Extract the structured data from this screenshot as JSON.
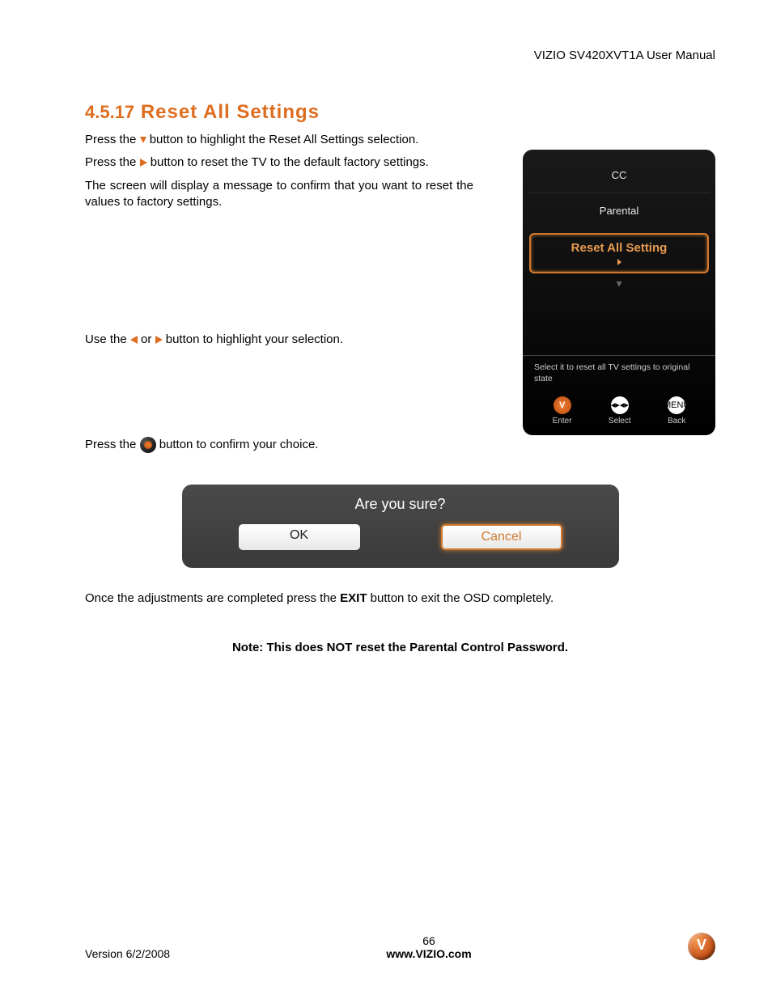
{
  "header": {
    "manual_title": "VIZIO SV420XVT1A User Manual"
  },
  "section": {
    "number": "4.5.17",
    "title": "Reset All Settings"
  },
  "paragraphs": {
    "p1a": "Press the ",
    "p1b": " button to highlight the Reset All Settings selection.",
    "p2a": "Press the ",
    "p2b": " button to reset the TV to the default factory settings.",
    "p3": "The screen will display a message to confirm that you want to reset the values to factory settings.",
    "p4a": "Use the ",
    "p4b": " or ",
    "p4c": " button to highlight your selection.",
    "p5a": "Press the ",
    "p5b": " button to confirm your choice.",
    "p6a": "Once the adjustments are completed press the ",
    "p6_exit": "EXIT",
    "p6b": " button to exit the OSD completely."
  },
  "tv_panel": {
    "item_cc": "CC",
    "item_parental": "Parental",
    "highlight": "Reset All Setting",
    "help_text": "Select it to reset all TV settings to original state",
    "btn_enter": "Enter",
    "btn_select": "Select",
    "btn_back": "Back",
    "menu_label": "MENU"
  },
  "dialog": {
    "title": "Are you sure?",
    "ok": "OK",
    "cancel": "Cancel"
  },
  "note": "Note: This does NOT reset the Parental Control Password",
  "footer": {
    "version": "Version 6/2/2008",
    "page": "66",
    "url": "www.VIZIO.com"
  }
}
